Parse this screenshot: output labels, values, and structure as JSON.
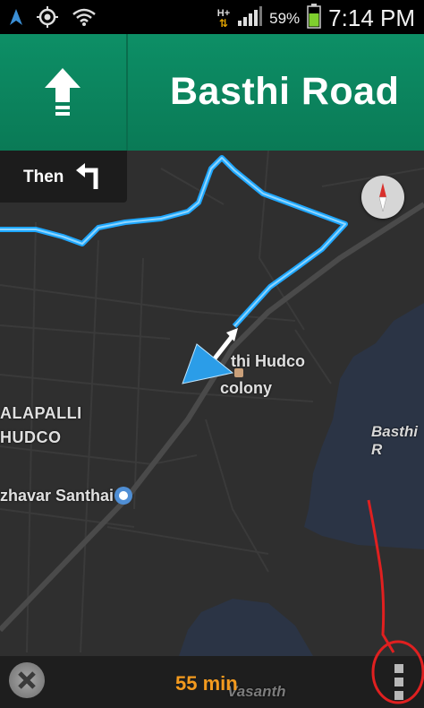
{
  "status_bar": {
    "network_label": "H+",
    "battery_percent": "59%",
    "time": "7:14 PM",
    "icons": [
      "navigation-icon",
      "gps-icon",
      "wifi-icon",
      "data-arrows-icon",
      "signal-icon",
      "battery-icon"
    ]
  },
  "banner": {
    "direction_icon": "arrow-up-icon",
    "road_name": "Basthi Road"
  },
  "then": {
    "label": "Then",
    "icon": "turn-left-icon"
  },
  "map": {
    "labels": {
      "hudco_line1": "thi Hudco",
      "hudco_line2": "colony",
      "lapalli_line1": "ALAPALLI",
      "lapalli_line2": "HUDCO",
      "santhai": "zhavar Santhai",
      "basthi": "Basthi R",
      "vasanth": "Vasanth"
    },
    "colors": {
      "route": "#1ea7ff",
      "water": "#2b3445",
      "land": "#2f2f2f"
    }
  },
  "bottom_bar": {
    "eta": "55 min",
    "icons": [
      "close-icon",
      "overflow-menu-icon"
    ],
    "eta_color": "#f39a1e"
  }
}
